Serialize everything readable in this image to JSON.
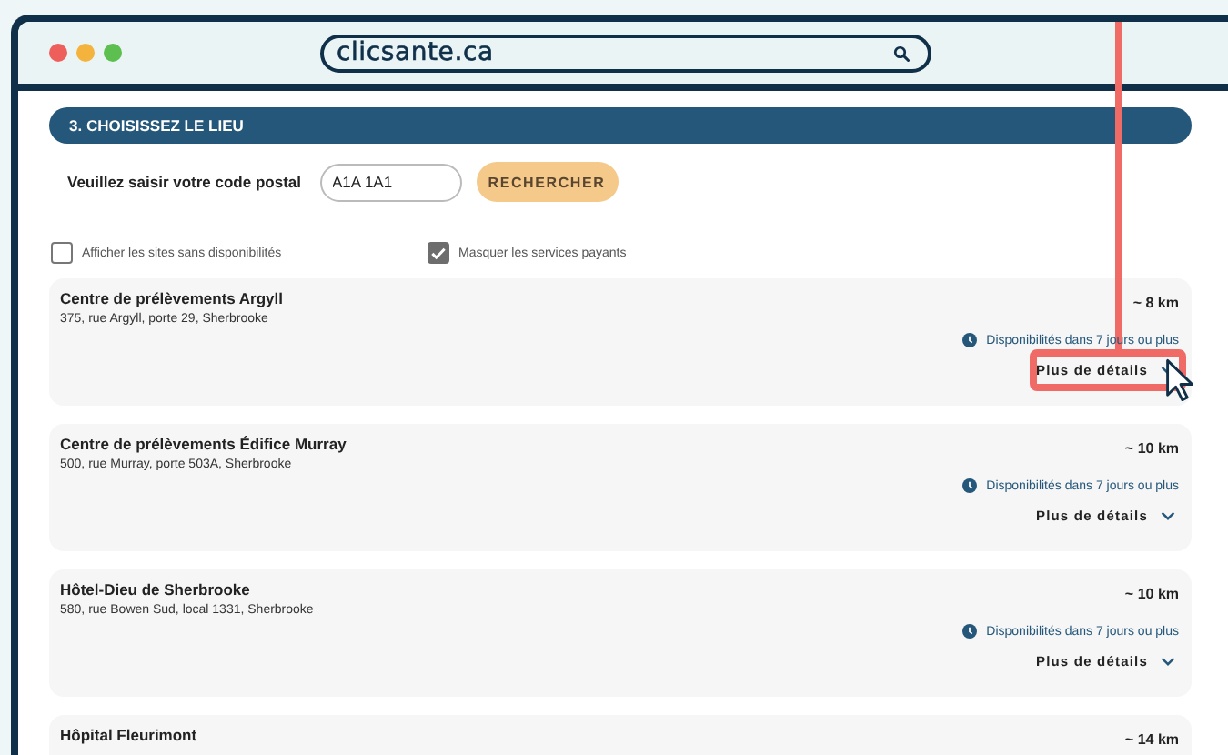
{
  "browser": {
    "url": "clicsante.ca"
  },
  "section": {
    "title": "3. CHOISISSEZ LE LIEU"
  },
  "postal": {
    "label": "Veuillez saisir votre code postal",
    "value": "A1A 1A1",
    "button": "RECHERCHER"
  },
  "filters": [
    {
      "label": "Afficher les sites sans disponibilités",
      "checked": false
    },
    {
      "label": "Masquer les services payants",
      "checked": true
    }
  ],
  "sites": [
    {
      "name": "Centre de prélèvements Argyll",
      "address": "375, rue Argyll, porte 29, Sherbrooke",
      "distance": "~ 8 km",
      "availability": "Disponibilités dans 7 jours ou plus",
      "details": "Plus de détails",
      "highlighted": true
    },
    {
      "name": "Centre de prélèvements Édifice Murray",
      "address": "500, rue Murray, porte 503A, Sherbrooke",
      "distance": "~ 10 km",
      "availability": "Disponibilités dans 7 jours ou plus",
      "details": "Plus de détails",
      "highlighted": false
    },
    {
      "name": "Hôtel-Dieu de Sherbrooke",
      "address": "580, rue Bowen Sud, local 1331, Sherbrooke",
      "distance": "~ 10 km",
      "availability": "Disponibilités dans 7 jours ou plus",
      "details": "Plus de détails",
      "highlighted": false
    },
    {
      "name": "Hôpital Fleurimont",
      "distance": "~ 14 km",
      "highlighted": false
    }
  ]
}
